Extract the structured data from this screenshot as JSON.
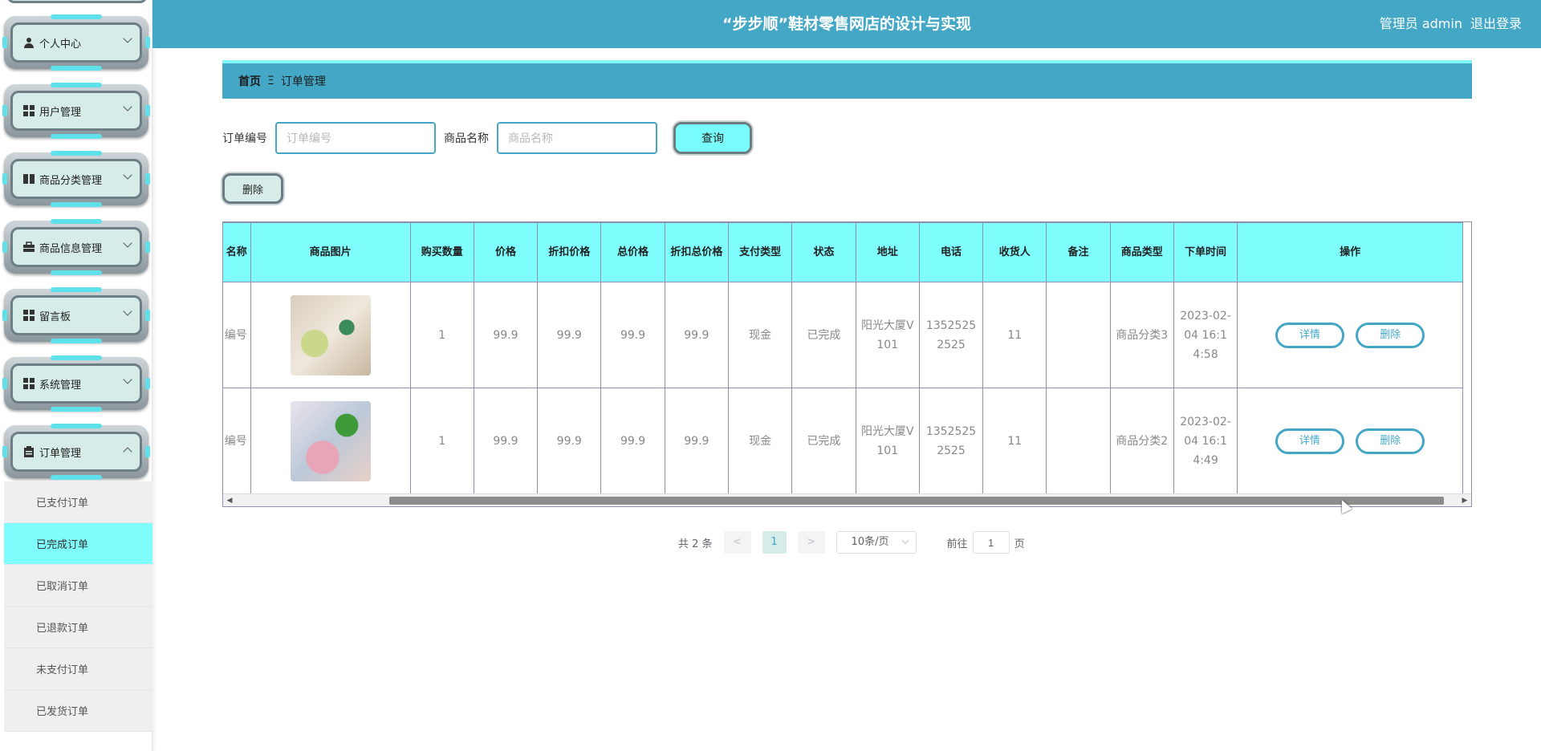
{
  "header": {
    "title": "“步步顺”鞋材零售网店的设计与实现",
    "user": "管理员 admin",
    "logout": "退出登录"
  },
  "sidebar": {
    "items": [
      {
        "label": "个人中心",
        "icon": "user-icon"
      },
      {
        "label": "用户管理",
        "icon": "grid-icon"
      },
      {
        "label": "商品分类管理",
        "icon": "book-icon"
      },
      {
        "label": "商品信息管理",
        "icon": "briefcase-icon"
      },
      {
        "label": "留言板",
        "icon": "grid-icon"
      },
      {
        "label": "系统管理",
        "icon": "grid-icon"
      },
      {
        "label": "订单管理",
        "icon": "clipboard-icon"
      }
    ],
    "sub_items": [
      "已支付订单",
      "已完成订单",
      "已取消订单",
      "已退款订单",
      "未支付订单",
      "已发货订单"
    ]
  },
  "breadcrumb": {
    "home": "首页",
    "separator": "Ξ",
    "current": "订单管理"
  },
  "search": {
    "order_label": "订单编号",
    "order_placeholder": "订单编号",
    "product_label": "商品名称",
    "product_placeholder": "商品名称",
    "query_button": "查询"
  },
  "delete_button": "删除",
  "table": {
    "headers": [
      "名称",
      "商品图片",
      "购买数量",
      "价格",
      "折扣价格",
      "总价格",
      "折扣总价格",
      "支付类型",
      "状态",
      "地址",
      "电话",
      "收货人",
      "备注",
      "商品类型",
      "下单时间",
      "操作"
    ],
    "rows": [
      {
        "name": "编号",
        "qty": "1",
        "price": "99.9",
        "disc_price": "99.9",
        "total": "99.9",
        "disc_total": "99.9",
        "pay_type": "现金",
        "status": "已完成",
        "address": "阳光大厦V101",
        "phone": "13525252525",
        "receiver": "11",
        "note": "",
        "category": "商品分类3",
        "time": "2023-02-04 16:14:58"
      },
      {
        "name": "编号",
        "qty": "1",
        "price": "99.9",
        "disc_price": "99.9",
        "total": "99.9",
        "disc_total": "99.9",
        "pay_type": "现金",
        "status": "已完成",
        "address": "阳光大厦V101",
        "phone": "13525252525",
        "receiver": "11",
        "note": "",
        "category": "商品分类2",
        "time": "2023-02-04 16:14:49"
      }
    ],
    "ops": {
      "detail": "详情",
      "delete": "删除"
    }
  },
  "pagination": {
    "total": "共 2 条",
    "prev": "<",
    "next": ">",
    "page": "1",
    "page_size": "10条/页",
    "goto_prefix": "前往",
    "goto_value": "1",
    "goto_suffix": "页"
  }
}
